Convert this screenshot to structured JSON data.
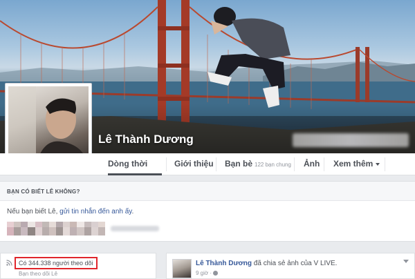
{
  "profile": {
    "name": "Lê Thành Dương"
  },
  "nav": {
    "timeline": "Dòng thời gian",
    "about": "Giới thiệu",
    "friends": "Bạn bè",
    "friends_mutual": "122 bạn chung",
    "photos": "Ảnh",
    "more": "Xem thêm"
  },
  "know_card": {
    "title": "BẠN CÓ BIẾT LÊ KHÔNG?",
    "text_prefix": "Nếu bạn biết Lê, ",
    "text_link": "gửi tin nhắn đến anh ấy",
    "text_suffix": "."
  },
  "follow": {
    "count_text": "Có 344.338 người theo dõi",
    "subtext": "Bạn theo dõi Lê"
  },
  "post": {
    "author": "Lê Thành Dương",
    "action": " đã chia sẻ ảnh của V LIVE.",
    "time": "9 giờ ·"
  },
  "colors": {
    "link": "#365899",
    "highlight_box": "#e0252b",
    "page_bg": "#e9ebee"
  }
}
